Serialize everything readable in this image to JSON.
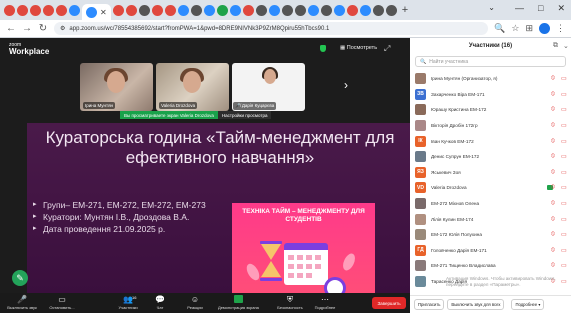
{
  "browser": {
    "tab_colors": [
      "#e0483e",
      "#e0483e",
      "#e0483e",
      "#e0483e",
      "#e0483e",
      "#2d8cff",
      "#1a73e8",
      "#e0483e",
      "#e0483e",
      "#555555",
      "#e0483e",
      "#e0483e",
      "#2d8cff",
      "#555555",
      "#2d8cff",
      "#1fa34a",
      "#2d8cff",
      "#e0483e",
      "#555555",
      "#2d8cff",
      "#555555",
      "#555555",
      "#2d8cff",
      "#555555",
      "#2d8cff",
      "#e0483e",
      "#2d8cff",
      "#555555",
      "#555555"
    ],
    "url": "app.zoom.us/wc/78554385692/start?fromPWA=1&pwd=8DRE9NIVNk3P9ZrM8Qpiru55hTbcs90.1"
  },
  "zoom": {
    "logo_small": "zoom",
    "logo_big": "Workplace",
    "view_label": "Посмотреть",
    "gallery": [
      {
        "name": "Ірина Мунтян"
      },
      {
        "name": "Valeria Drozdova"
      },
      {
        "name": "Дарія Куцарєва"
      }
    ],
    "share_notice": "Вы просматриваете экран Valeria Drozdova",
    "share_settings": "Настройки просмотра",
    "slide": {
      "title": "Кураторська година «Тайм-менеджмент для ефективного навчання»",
      "bullets": [
        "Групи– ЕМ-271, ЕМ-272, ЕМ-272, ЕМ-273",
        "Куратори: Мунтян І.В., Дроздова В.А.",
        "Дата проведення 21.09.2025 р."
      ],
      "poster_title": "ТЕХНІКА ТАЙМ – МЕНЕДЖМЕНТУ ДЛЯ СТУДЕНТІВ"
    },
    "toolbar": [
      {
        "label": "Выключить звук",
        "icon": "mic-icon"
      },
      {
        "label": "Остановить...",
        "icon": "video-icon"
      },
      {
        "label": "Участники",
        "icon": "participants-icon",
        "count": "16"
      },
      {
        "label": "Чат",
        "icon": "chat-icon"
      },
      {
        "label": "Реакции",
        "icon": "reaction-icon"
      },
      {
        "label": "Демонстрация экрана",
        "icon": "share-icon"
      },
      {
        "label": "Безопасность",
        "icon": "shield-icon"
      },
      {
        "label": "Подробнее",
        "icon": "more-icon"
      }
    ],
    "end_label": "Завершить"
  },
  "panel": {
    "title": "Участники (16)",
    "search_placeholder": "Найти участника",
    "participants": [
      {
        "name": "Ірина Мунтян (Организатор, я)",
        "initials": "",
        "color": "#9a7a6a",
        "camera": false
      },
      {
        "name": "Захарченко Віра ЕМ-171",
        "initials": "ЗВ",
        "color": "#3b6fd1",
        "camera": false
      },
      {
        "name": "Юрашу Кристина ЕМ-172",
        "initials": "",
        "color": "#8a6a5a",
        "camera": false
      },
      {
        "name": "Вікторія Дробін 172гр",
        "initials": "",
        "color": "#a88",
        "camera": false
      },
      {
        "name": "Іван Кучков ЕМ-172",
        "initials": "ІК",
        "color": "#e8622a",
        "camera": false
      },
      {
        "name": "Денис Супрун ЕМ-172",
        "initials": "",
        "color": "#6a7a8a",
        "camera": false
      },
      {
        "name": "Яськевич Зоя",
        "initials": "ЯЗ",
        "color": "#e8622a",
        "camera": false
      },
      {
        "name": "Valeria Drozdova",
        "initials": "VD",
        "color": "#e8622a",
        "camera": true
      },
      {
        "name": "ЕМ-272 Міхнов Олена",
        "initials": "",
        "color": "#7a6a6a",
        "camera": false
      },
      {
        "name": "Лілія Кулин ЕМ-174",
        "initials": "",
        "color": "#b09080",
        "camera": false
      },
      {
        "name": "ЕМ-172 Юлія Полухина",
        "initials": "",
        "color": "#9a8a7a",
        "camera": false
      },
      {
        "name": "Головченко Дарія ЕМ-171",
        "initials": "ГД",
        "color": "#e8622a",
        "camera": false
      },
      {
        "name": "ЕМ-271 Тищенко Владислава",
        "initials": "",
        "color": "#8a7a7a",
        "camera": false
      },
      {
        "name": "Тарасенко Дарія",
        "initials": "",
        "color": "#6a8a9a",
        "camera": false
      }
    ],
    "activate_windows": "Активация Windows. Чтобы активировать Windows, перейдите в раздел «Параметры».",
    "invite_label": "Пригласить",
    "mute_all_label": "Выключить звук для всех",
    "more_label": "Подробнее ▾"
  }
}
